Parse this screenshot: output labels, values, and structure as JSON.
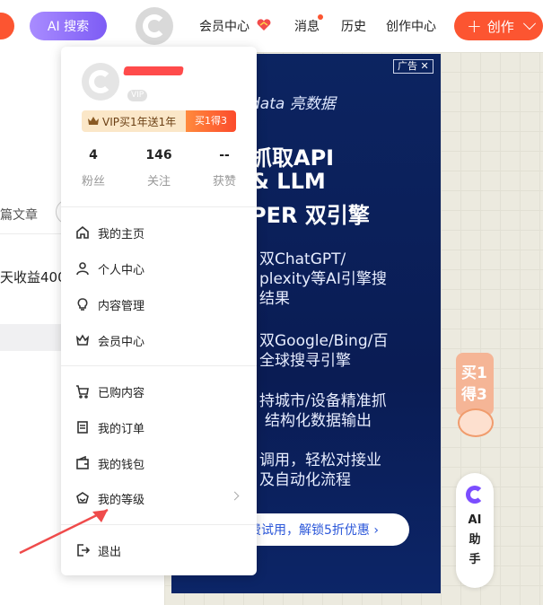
{
  "nav": {
    "ai_search": "AI 搜索",
    "member_center": "会员中心",
    "messages": "消息",
    "history": "历史",
    "creator_center": "创作中心",
    "create": "创作",
    "accent_color": "#fc5531"
  },
  "background": {
    "left_text_1": "篇文章",
    "left_text_2": "天收益400"
  },
  "user_menu": {
    "vip_badge": "VIP",
    "vip_promo": "VIP买1年送1年",
    "vip_buy": "买1得3",
    "stats": [
      {
        "value": "4",
        "label": "粉丝"
      },
      {
        "value": "146",
        "label": "关注"
      },
      {
        "value": "--",
        "label": "获赞"
      }
    ],
    "items": [
      {
        "label": "我的主页",
        "icon": "home-icon"
      },
      {
        "label": "个人中心",
        "icon": "user-icon"
      },
      {
        "label": "内容管理",
        "icon": "bulb-icon"
      },
      {
        "label": "会员中心",
        "icon": "crown-icon"
      },
      {
        "label": "已购内容",
        "icon": "cart-icon"
      },
      {
        "label": "我的订单",
        "icon": "order-icon"
      },
      {
        "label": "我的钱包",
        "icon": "wallet-icon"
      },
      {
        "label": "我的等级",
        "icon": "level-icon"
      },
      {
        "label": "退出",
        "icon": "logout-icon"
      }
    ]
  },
  "ad": {
    "tag": "广告 ✕",
    "brand": "data 亮数据",
    "title_1": "抓取API",
    "title_2": "& LLM",
    "title_3": "PER 双引擎",
    "line_1": "双ChatGPT/",
    "line_2": "plexity等AI引擎搜",
    "line_3": "结果",
    "line_4": "双Google/Bing/百",
    "line_5": "全球搜寻引擎",
    "line_6": "持城市/设备精准抓",
    "line_7": "结构化数据输出",
    "line_8": "调用，轻松对接业",
    "line_9": "及自动化流程",
    "cta": "费试用，解锁5折优惠 ›"
  },
  "float": {
    "buy_1": "买1",
    "buy_2": "得3",
    "ai_helper": [
      "AI",
      "助",
      "手"
    ]
  }
}
